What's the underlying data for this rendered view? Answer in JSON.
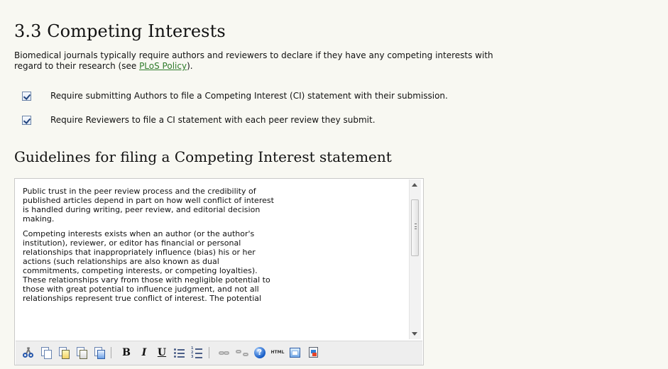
{
  "section": {
    "title": "3.3 Competing Interests",
    "intro_line1": "Biomedical journals typically require authors and reviewers to declare if they have any competing interests with",
    "intro_line2_before": "regard to their research (see ",
    "policy_link": "PLoS Policy",
    "intro_line2_after": ")."
  },
  "options": [
    {
      "label": "Require submitting Authors to file a Competing Interest (CI) statement with their submission.",
      "checked": true
    },
    {
      "label": "Require Reviewers to file a CI statement with each peer review they submit.",
      "checked": true
    }
  ],
  "guidelines": {
    "title": "Guidelines for filing a Competing Interest statement",
    "paragraphs": [
      "Public trust in the peer review process and the credibility of\npublished articles depend in part on how well conflict of interest\nis handled during writing, peer review, and editorial decision\nmaking.",
      "Competing interests exists when an author (or the author's\ninstitution), reviewer, or editor has financial or personal\nrelationships that inappropriately influence (bias) his or her\nactions (such relationships are also known as dual\ncommitments, competing interests, or competing loyalties).\nThese relationships vary from those with negligible potential to\nthose with great potential to influence judgment, and not all\nrelationships represent true conflict of interest. The potential"
    ]
  },
  "toolbar": {
    "bold": "B",
    "italic": "I",
    "underline": "U",
    "html": "HTML"
  },
  "icons": [
    "cut-icon",
    "copy-icon",
    "paste-icon",
    "paste-text-icon",
    "paste-word-icon",
    "bold-icon",
    "italic-icon",
    "underline-icon",
    "bullet-list-icon",
    "numbered-list-icon",
    "link-icon",
    "unlink-icon",
    "help-icon",
    "html-icon",
    "fullscreen-icon",
    "image-icon"
  ]
}
